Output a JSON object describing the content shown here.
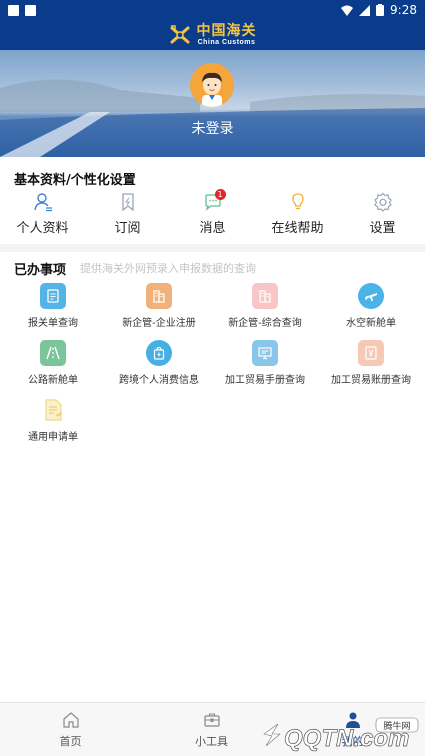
{
  "status_bar": {
    "time": "9:28"
  },
  "header": {
    "logo_cn": "中国海关",
    "logo_en": "China Customs"
  },
  "profile": {
    "login_status": "未登录"
  },
  "section_basic": {
    "title": "基本资料/个性化设置",
    "items": [
      {
        "label": "个人资料",
        "icon": "person-icon"
      },
      {
        "label": "订阅",
        "icon": "bookmark-icon"
      },
      {
        "label": "消息",
        "icon": "chat-icon",
        "badge": "1"
      },
      {
        "label": "在线帮助",
        "icon": "lightbulb-icon"
      },
      {
        "label": "设置",
        "icon": "gear-icon"
      }
    ]
  },
  "section_done": {
    "title": "已办事项",
    "hint": "提供海关外网预录入申报数据的查询",
    "rows": [
      [
        {
          "label": "报关单查询",
          "icon": "document-icon",
          "color": "#55b4e6"
        },
        {
          "label": "新企管-企业注册",
          "icon": "building-icon",
          "color": "#f0b27a"
        },
        {
          "label": "新企管-综合查询",
          "icon": "building-search-icon",
          "color": "#f7c7c7"
        },
        {
          "label": "水空新舱单",
          "icon": "plane-icon",
          "color": "#4ab3e8"
        }
      ],
      [
        {
          "label": "公路新舱单",
          "icon": "road-icon",
          "color": "#7cc49a"
        },
        {
          "label": "跨境个人消费信息",
          "icon": "bag-icon",
          "color": "#45b1e2"
        },
        {
          "label": "加工贸易手册查询",
          "icon": "monitor-icon",
          "color": "#8ac6ea"
        },
        {
          "label": "加工贸易账册查询",
          "icon": "yen-book-icon",
          "color": "#f6c9b4"
        }
      ],
      [
        {
          "label": "通用申请单",
          "icon": "form-icon",
          "color": "#f7e4a8"
        }
      ]
    ]
  },
  "bottom_nav": {
    "items": [
      {
        "label": "首页",
        "icon": "home-icon"
      },
      {
        "label": "小工具",
        "icon": "toolbox-icon"
      },
      {
        "label": "我的",
        "icon": "user-icon",
        "active": true
      }
    ]
  },
  "watermark": {
    "site_cn": "腾牛网",
    "site_en": "QQTN.com"
  },
  "colors": {
    "brand_blue": "#0b3c8c",
    "badge_red": "#e02828",
    "active_nav": "#1f4e9a"
  }
}
